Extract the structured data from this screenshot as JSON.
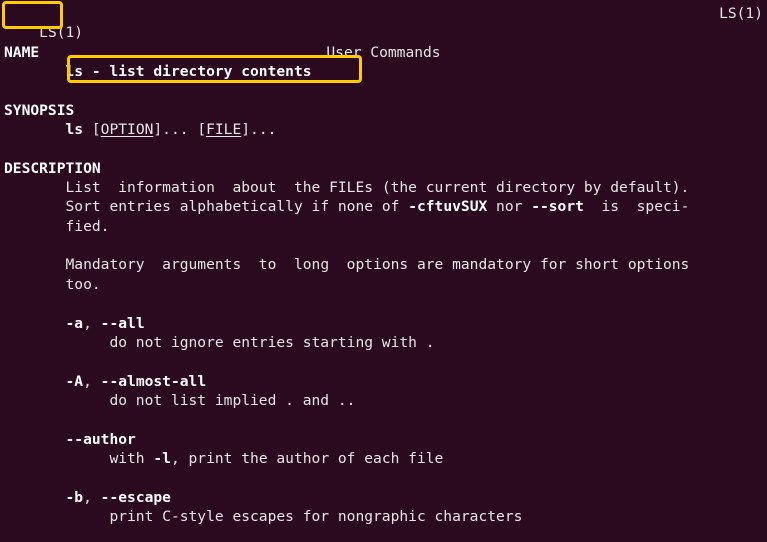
{
  "terminal": {
    "background_color": "#2b0a1f",
    "foreground_color": "#e6e6e6",
    "highlight_color": "#ffcc00"
  },
  "header": {
    "left": "LS(1)",
    "center": "User Commands",
    "right": "LS(1)"
  },
  "sections": {
    "name": {
      "heading": "NAME",
      "body": "ls - list directory contents"
    },
    "synopsis": {
      "heading": "SYNOPSIS",
      "command": "ls",
      "open_bracket_1": " [",
      "option": "OPTION",
      "after_option": "]... [",
      "file": "FILE",
      "after_file": "]..."
    },
    "description": {
      "heading": "DESCRIPTION",
      "para1_line1": "List  information  about  the FILEs (the current directory by default).",
      "para1_line2_a": "Sort entries alphabetically if none of ",
      "para1_line2_b": "-cftuvSUX",
      "para1_line2_c": " nor ",
      "para1_line2_d": "--sort",
      "para1_line2_e": "  is  speci-",
      "para1_line3": "fied.",
      "para2_line1": "Mandatory  arguments  to  long  options are mandatory for short options",
      "para2_line2": "too."
    }
  },
  "options": [
    {
      "short": "-a",
      "separator": ", ",
      "long": "--all",
      "description": "do not ignore entries starting with ."
    },
    {
      "short": "-A",
      "separator": ", ",
      "long": "--almost-all",
      "description": "do not list implied . and .."
    },
    {
      "short": "",
      "separator": "",
      "long": "--author",
      "description_pre": "with ",
      "description_bold": "-l",
      "description_post": ", print the author of each file"
    },
    {
      "short": "-b",
      "separator": ", ",
      "long": "--escape",
      "description": "print C-style escapes for nongraphic characters"
    }
  ],
  "annotations": {
    "title_box_label": "LS(1)",
    "name_box_label": "ls - list directory contents"
  }
}
